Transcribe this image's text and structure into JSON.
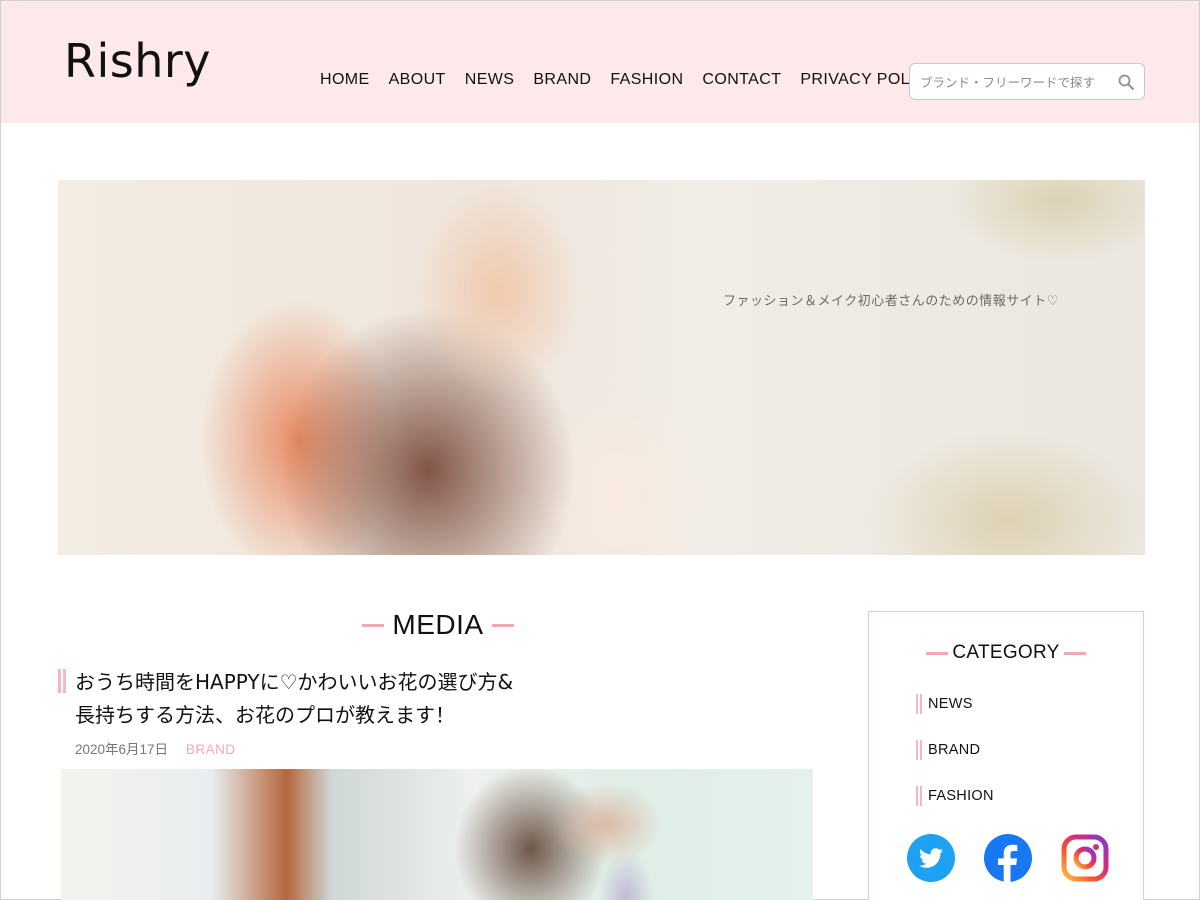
{
  "header": {
    "logo": "Rishry",
    "nav": [
      "HOME",
      "ABOUT",
      "NEWS",
      "BRAND",
      "FASHION",
      "CONTACT",
      "PRIVACY POLICY"
    ],
    "search_placeholder": "ブランド・フリーワードで探す"
  },
  "hero": {
    "tagline": "ファッション＆メイク初心者さんのための情報サイト♡"
  },
  "main": {
    "section_title": "MEDIA",
    "post": {
      "title_line1": "おうち時間をHAPPYに♡かわいいお花の選び方&",
      "title_line2": "長持ちする方法、お花のプロが教えます！",
      "date": "2020年6月17日",
      "category": "BRAND"
    }
  },
  "sidebar": {
    "title": "CATEGORY",
    "categories": [
      "NEWS",
      "BRAND",
      "FASHION"
    ],
    "social": [
      "twitter-icon",
      "facebook-icon",
      "instagram-icon"
    ]
  },
  "colors": {
    "header_bg": "#fde9ea",
    "accent_pink": "#f2a9b5",
    "twitter": "#1da1f2",
    "facebook": "#1877f2"
  }
}
